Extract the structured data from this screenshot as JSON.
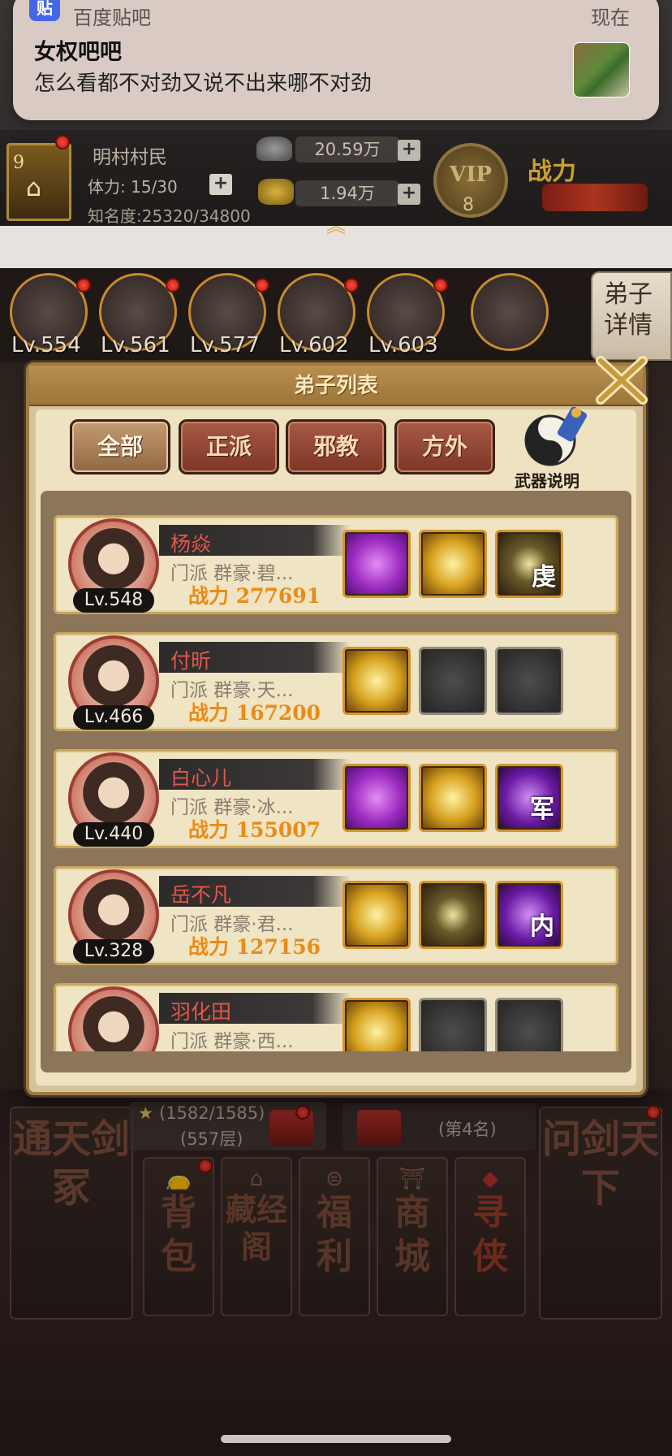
{
  "notification": {
    "app_icon": "贴",
    "app_name": "百度贴吧",
    "time": "现在",
    "title": "女权吧吧",
    "body": "怎么看都不对劲又说不出来哪不对劲",
    "thumbnail_icon": "food-photo-thumbnail"
  },
  "player": {
    "level": "9",
    "name": "明村村民",
    "stamina": "体力: 15/30",
    "fame": "知名度:25320/34800",
    "silver": "20.59万",
    "gold": "1.94万",
    "plus": "+",
    "vip_label": "VIP",
    "vip_level": "8",
    "power_label": "战力"
  },
  "hero_strip": {
    "levels": [
      "Lv.554",
      "Lv.561",
      "Lv.577",
      "Lv.602",
      "Lv.603"
    ],
    "detail_tab": "弟子\n详情"
  },
  "panel": {
    "title": "弟子列表",
    "tabs": [
      "全部",
      "正派",
      "邪教",
      "方外"
    ],
    "active_tab": "全部",
    "weapon_help": "武器说明",
    "disciples": [
      {
        "name": "杨焱",
        "school": "门派   群豪·碧...",
        "power": "战力 277691",
        "level": "Lv.548",
        "skills": [
          "purple",
          "gold",
          "dark"
        ],
        "skill_glyphs": [
          "",
          "",
          "虔"
        ]
      },
      {
        "name": "付昕",
        "school": "门派   群豪·天...",
        "power": "战力 167200",
        "level": "Lv.466",
        "skills": [
          "gold",
          "empty",
          "empty"
        ],
        "skill_glyphs": [
          "",
          "",
          ""
        ]
      },
      {
        "name": "白心儿",
        "school": "门派   群豪·冰...",
        "power": "战力 155007",
        "level": "Lv.440",
        "skills": [
          "purple",
          "gold",
          "violet"
        ],
        "skill_glyphs": [
          "",
          "",
          "军"
        ]
      },
      {
        "name": "岳不凡",
        "school": "门派   群豪·君...",
        "power": "战力 127156",
        "level": "Lv.328",
        "skills": [
          "gold",
          "dark",
          "violet"
        ],
        "skill_glyphs": [
          "",
          "",
          "内"
        ]
      },
      {
        "name": "羽化田",
        "school": "门派   群豪·西...",
        "power": "",
        "level": "",
        "skills": [
          "gold",
          "empty",
          "empty"
        ],
        "skill_glyphs": [
          "",
          "",
          ""
        ]
      }
    ]
  },
  "bottom": {
    "left_big": "通天剑冢",
    "right_big": "问剑天下",
    "progress_1_line1": "(1582/1585)",
    "progress_1_line2": "(557层)",
    "progress_2": "(第4名)",
    "menu": [
      {
        "label": "背包",
        "icon": "bag-icon"
      },
      {
        "label": "藏经阁",
        "icon": "pavilion-icon"
      },
      {
        "label": "福利",
        "icon": "chest-icon"
      },
      {
        "label": "商城",
        "icon": "shop-icon"
      },
      {
        "label": "寻侠",
        "icon": "seal-icon"
      }
    ]
  },
  "colors": {
    "accent_gold": "#c78a2e",
    "name_red": "#e2574a",
    "power_orange": "#ea8b16",
    "tab_red": "#7d3626"
  }
}
